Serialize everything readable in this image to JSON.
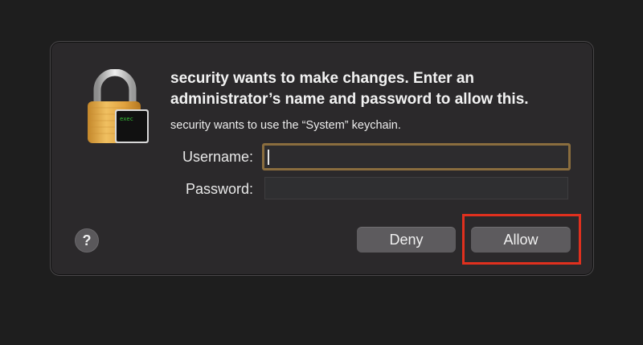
{
  "dialog": {
    "title": "security wants to make changes. Enter an administrator’s name and password to allow this.",
    "subtitle": "security wants to use the “System” keychain.",
    "lock_badge": "exec",
    "username_label": "Username:",
    "password_label": "Password:",
    "username_value": "",
    "password_value": "",
    "help_label": "?",
    "deny_label": "Deny",
    "allow_label": "Allow"
  },
  "colors": {
    "background": "#1e1e1e",
    "dialog": "#2b292b",
    "focus_ring": "#8a6d3e",
    "button": "#5d5b5e",
    "annotation": "#e0301e"
  },
  "icons": [
    "padlock-icon",
    "help-icon"
  ]
}
